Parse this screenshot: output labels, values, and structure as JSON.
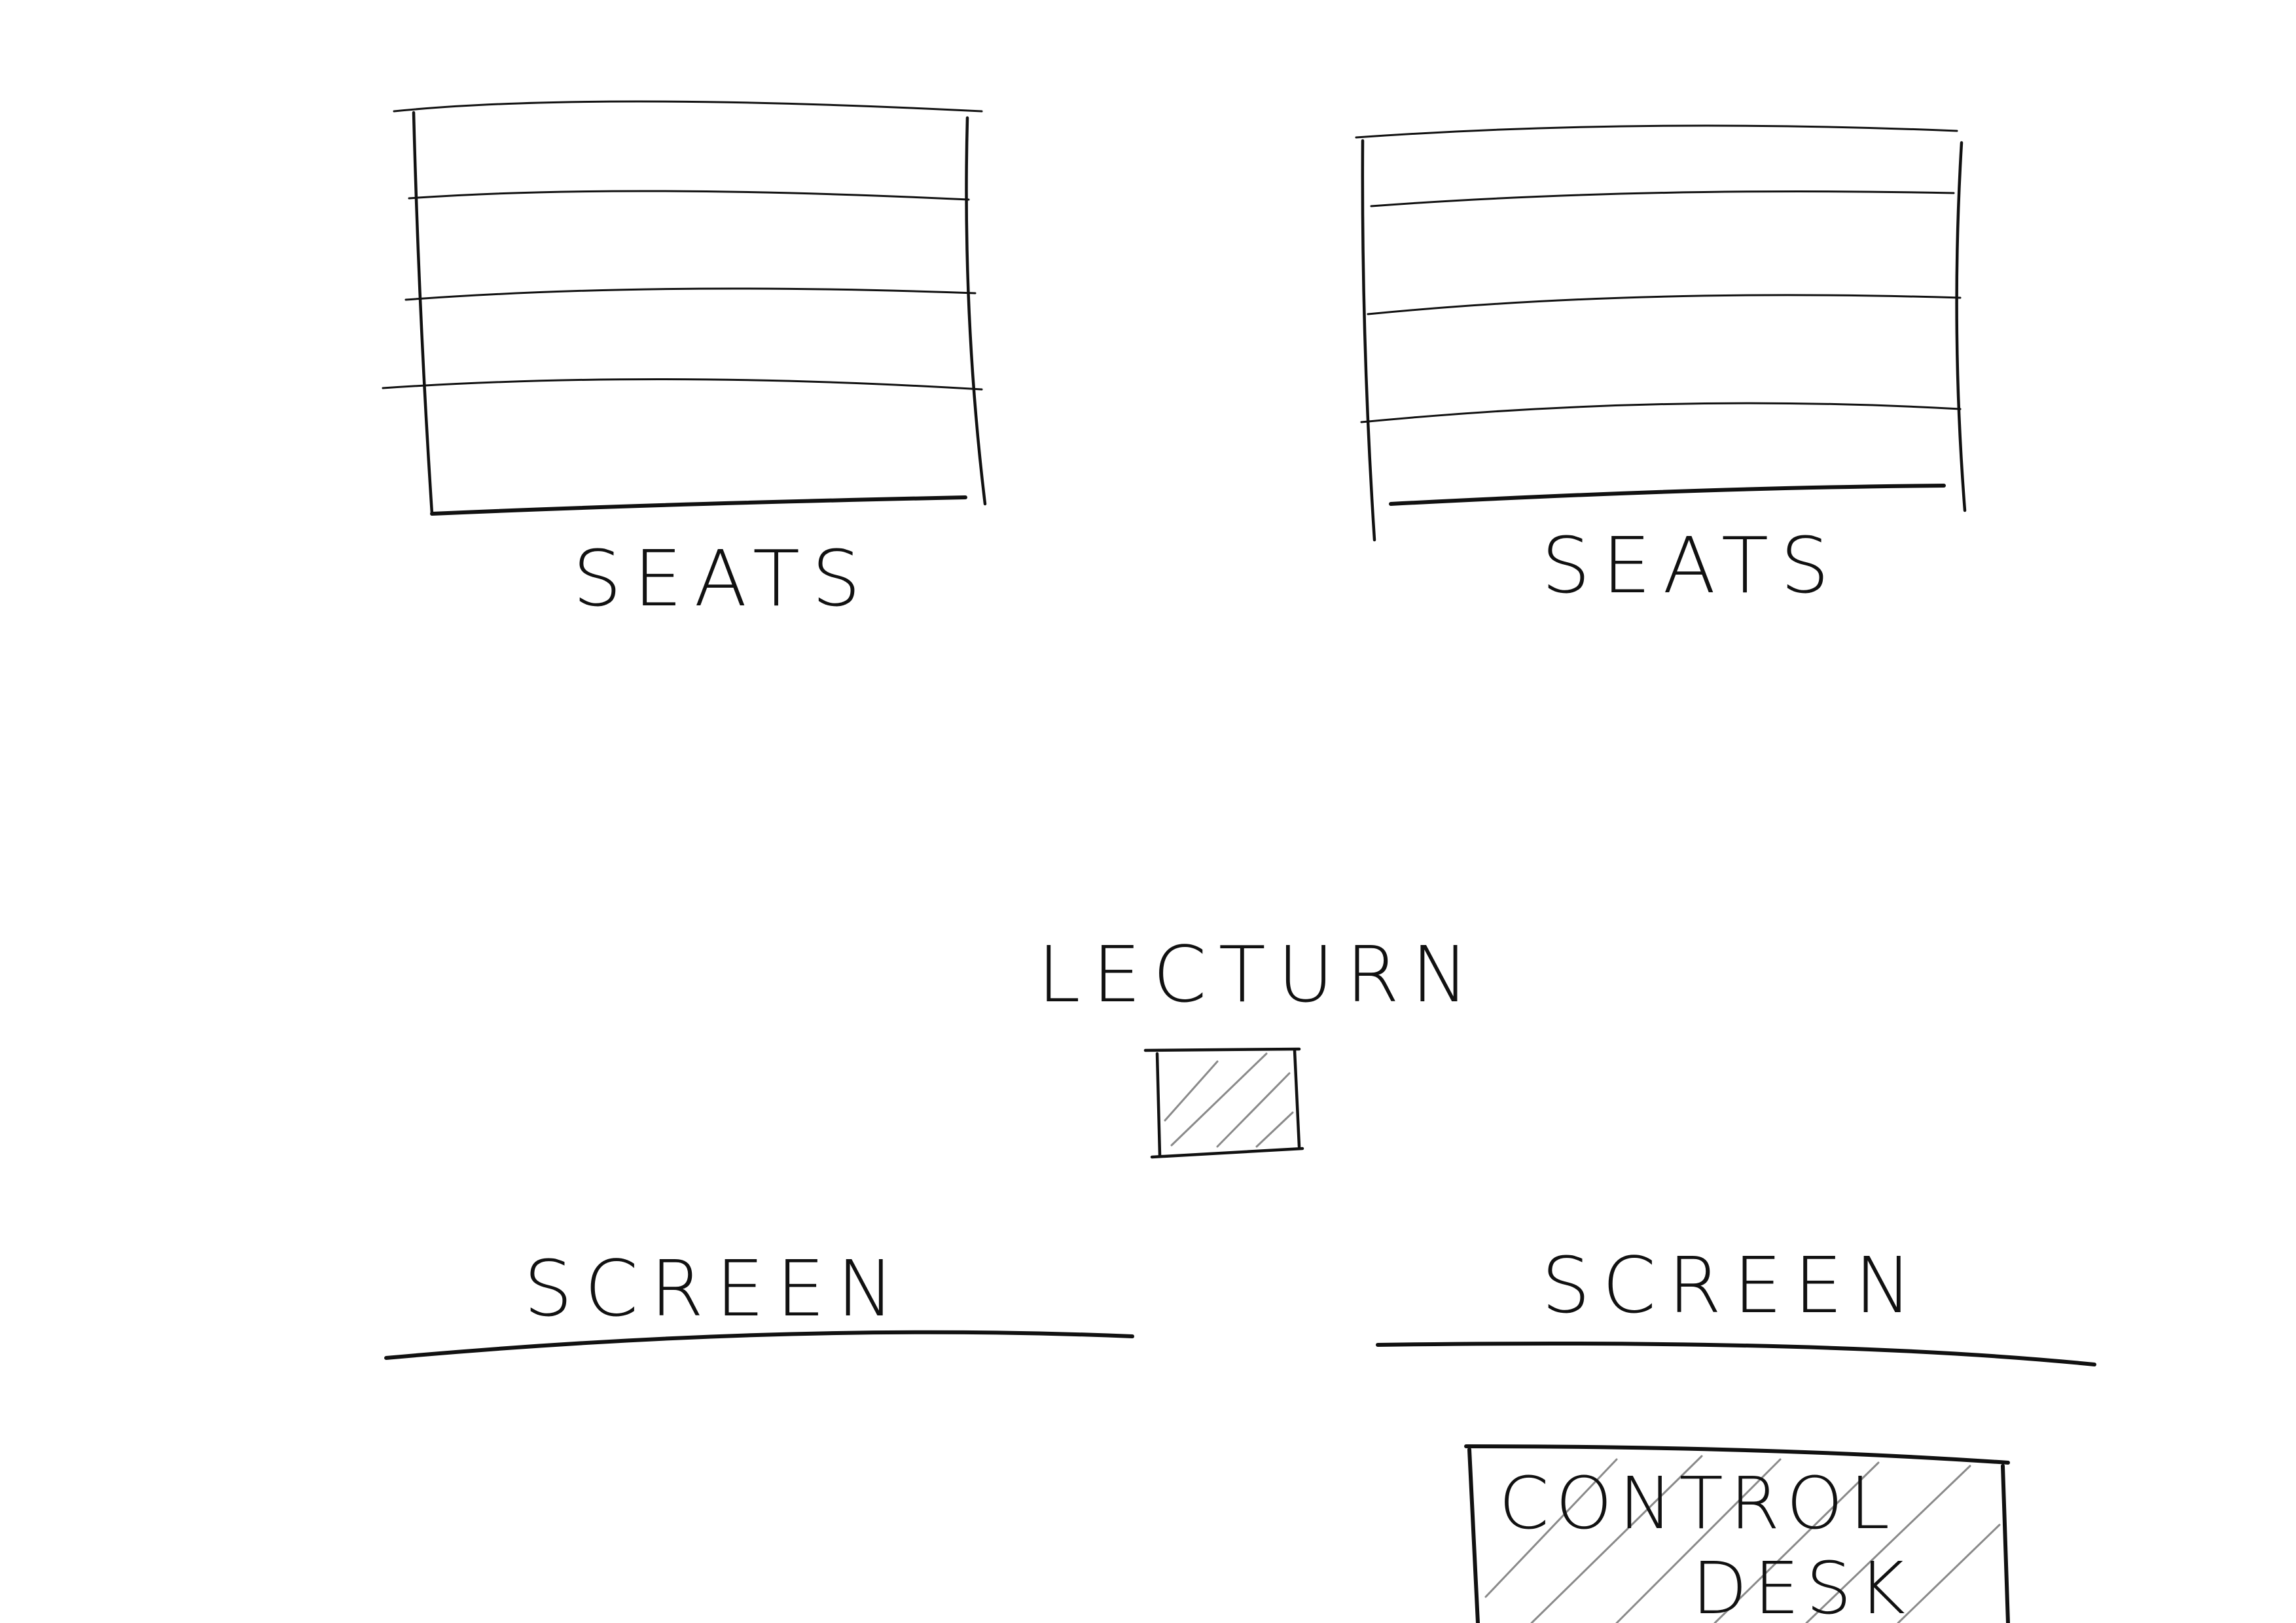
{
  "colors": {
    "ink": "#111111",
    "hatch": "#8a8a8a",
    "background": "#ffffff"
  },
  "diagram": {
    "seats_left": {
      "label": "SEATS",
      "rows": 4
    },
    "seats_right": {
      "label": "SEATS",
      "rows": 4
    },
    "lectern": {
      "label": "LECTURN"
    },
    "screen_left": {
      "label": "SCREEN"
    },
    "screen_right": {
      "label": "SCREEN"
    },
    "control_desk": {
      "label_line1": "CONTROL",
      "label_line2": "DESK"
    }
  }
}
